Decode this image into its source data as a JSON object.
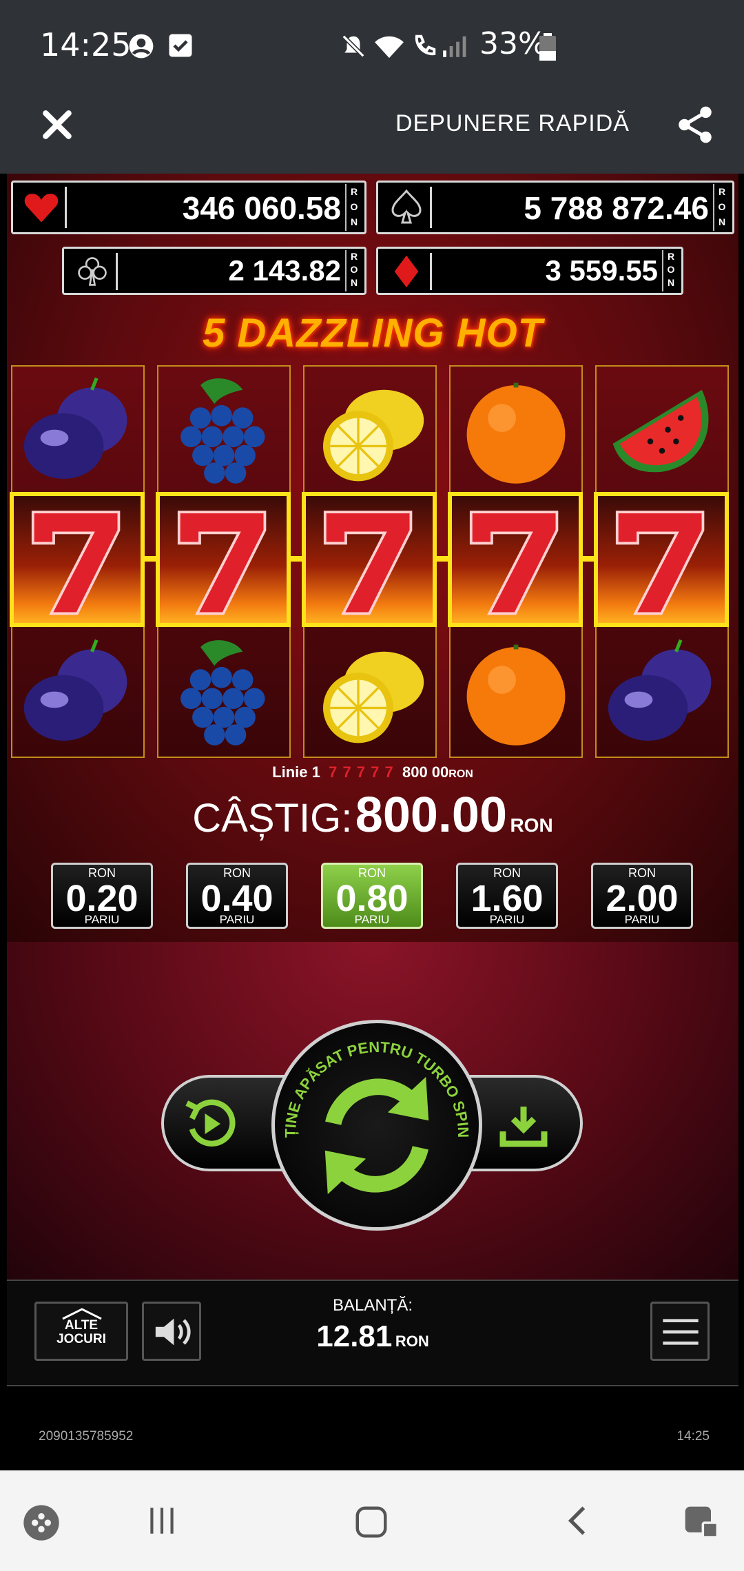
{
  "status_bar": {
    "time": "14:25",
    "battery": "33%",
    "icons": [
      "account-circle-icon",
      "checkbox-icon",
      "mute-icon",
      "wifi-icon",
      "wifi-call-icon",
      "signal-icon",
      "battery-icon"
    ]
  },
  "header": {
    "close_icon": "close-icon",
    "title": "DEPUNERE RAPIDĂ",
    "share_icon": "share-icon"
  },
  "jackpots": [
    {
      "suit": "heart",
      "value": "346 060.58",
      "currency": "RON"
    },
    {
      "suit": "spade",
      "value": "5 788 872.46",
      "currency": "RON"
    },
    {
      "suit": "club",
      "value": "2 143.82",
      "currency": "RON"
    },
    {
      "suit": "diamond",
      "value": "3 559.55",
      "currency": "RON"
    }
  ],
  "game_title": "5 DAZZLING HOT",
  "reels": [
    [
      "plum",
      "seven",
      "plum"
    ],
    [
      "grapes",
      "seven",
      "grapes"
    ],
    [
      "lemon",
      "seven",
      "lemon"
    ],
    [
      "orange",
      "seven",
      "orange"
    ],
    [
      "watermelon",
      "seven",
      "plum"
    ]
  ],
  "win_line": {
    "label": "Linie 1",
    "symbols": "7 7 7 7 7",
    "amount": "800 00",
    "currency": "RON"
  },
  "win": {
    "label": "CÂȘTIG:",
    "amount": "800.00",
    "currency": "RON"
  },
  "bets": [
    {
      "currency": "RON",
      "value": "0.20",
      "label": "PARIU",
      "active": false
    },
    {
      "currency": "RON",
      "value": "0.40",
      "label": "PARIU",
      "active": false
    },
    {
      "currency": "RON",
      "value": "0.80",
      "label": "PARIU",
      "active": true
    },
    {
      "currency": "RON",
      "value": "1.60",
      "label": "PARIU",
      "active": false
    },
    {
      "currency": "RON",
      "value": "2.00",
      "label": "PARIU",
      "active": false
    }
  ],
  "spin": {
    "hint": "ȚINE APĂSAT PENTRU TURBO SPIN",
    "autoplay_icon": "autoplay-icon",
    "spin_icon": "spin-arrows-icon",
    "collect_icon": "download-icon",
    "accent": "#8cd23c"
  },
  "bottom_bar": {
    "other_games_line1": "ALTE",
    "other_games_line2": "JOCURI",
    "sound_icon": "speaker-icon",
    "balance_label": "BALANȚĂ:",
    "balance_value": "12.81",
    "balance_currency": "RON",
    "menu_icon": "hamburger-menu-icon"
  },
  "footer": {
    "session_id": "2090135785952",
    "time": "14:25"
  },
  "nav_bar": {
    "icons": [
      "game-launcher-icon",
      "recent-apps-icon",
      "home-icon",
      "back-icon",
      "screen-lock-icon"
    ]
  }
}
